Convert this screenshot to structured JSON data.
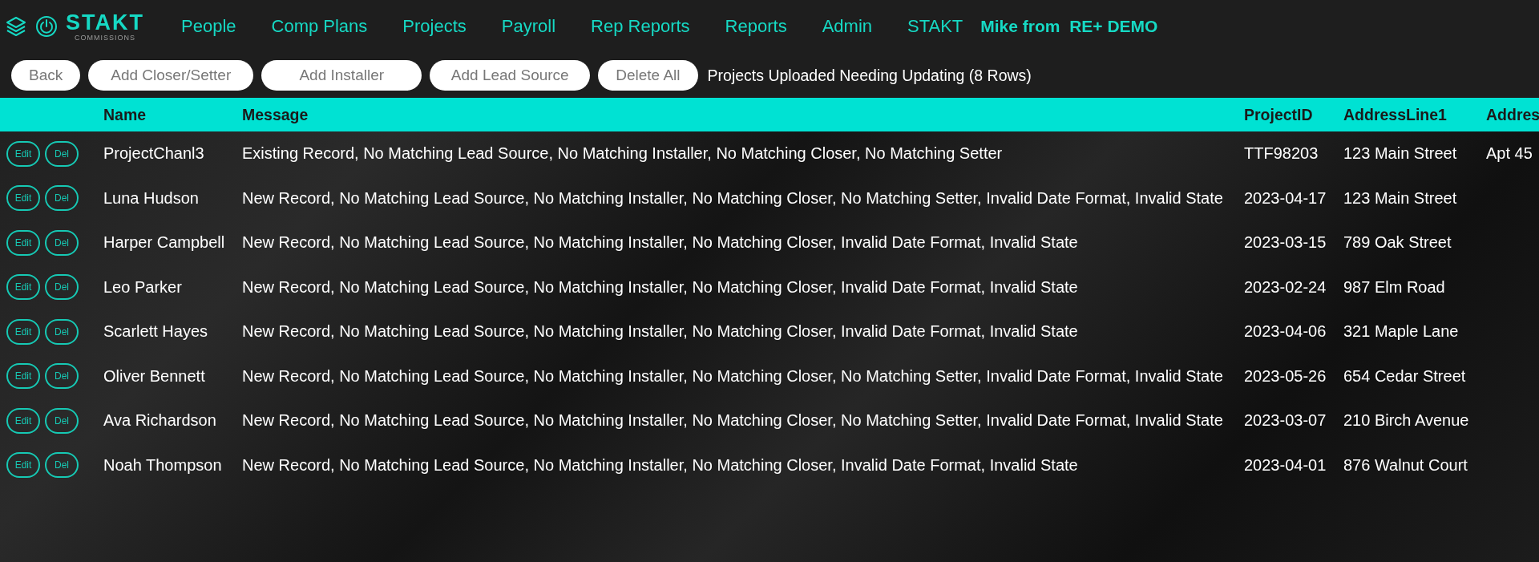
{
  "brand": {
    "name": "STAKT",
    "tagline": "COMMISSIONS"
  },
  "nav": [
    "People",
    "Comp Plans",
    "Projects",
    "Payroll",
    "Rep Reports",
    "Reports",
    "Admin",
    "STAKT"
  ],
  "user": "Mike from  RE+ DEMO",
  "toolbar": {
    "buttons": [
      "Back",
      "Add Closer/Setter",
      "Add Installer",
      "Add Lead Source",
      "Delete All"
    ],
    "title": "Projects Uploaded Needing Updating (8 Rows)"
  },
  "table": {
    "columns": [
      "Name",
      "Message",
      "ProjectID",
      "AddressLine1",
      "Addres"
    ],
    "rows": [
      {
        "actions": [
          "Edit",
          "Del"
        ],
        "cells": [
          "ProjectChanl3",
          "Existing Record, No Matching Lead Source, No Matching Installer, No Matching Closer, No Matching Setter",
          "TTF98203",
          "123 Main Street",
          "Apt 45"
        ]
      },
      {
        "actions": [
          "Edit",
          "Del"
        ],
        "cells": [
          "Luna Hudson",
          "New Record, No Matching Lead Source, No Matching Installer, No Matching Closer, No Matching Setter, Invalid Date Format, Invalid State",
          "2023-04-17",
          "123 Main Street"
        ]
      },
      {
        "actions": [
          "Edit",
          "Del"
        ],
        "cells": [
          "Harper Campbell",
          "New Record, No Matching Lead Source, No Matching Installer, No Matching Closer, Invalid Date Format, Invalid State",
          "2023-03-15",
          "789 Oak Street"
        ]
      },
      {
        "actions": [
          "Edit",
          "Del"
        ],
        "cells": [
          "Leo Parker",
          "New Record, No Matching Lead Source, No Matching Installer, No Matching Closer, Invalid Date Format, Invalid State",
          "2023-02-24",
          "987 Elm Road"
        ]
      },
      {
        "actions": [
          "Edit",
          "Del"
        ],
        "cells": [
          "Scarlett Hayes",
          "New Record, No Matching Lead Source, No Matching Installer, No Matching Closer, Invalid Date Format, Invalid State",
          "2023-04-06",
          "321 Maple Lane"
        ]
      },
      {
        "actions": [
          "Edit",
          "Del"
        ],
        "cells": [
          "Oliver Bennett",
          "New Record, No Matching Lead Source, No Matching Installer, No Matching Closer, No Matching Setter, Invalid Date Format, Invalid State",
          "2023-05-26",
          "654 Cedar Street"
        ]
      },
      {
        "actions": [
          "Edit",
          "Del"
        ],
        "cells": [
          "Ava Richardson",
          "New Record, No Matching Lead Source, No Matching Installer, No Matching Closer, No Matching Setter, Invalid Date Format, Invalid State",
          "2023-03-07",
          "210 Birch Avenue"
        ]
      },
      {
        "actions": [
          "Edit",
          "Del"
        ],
        "cells": [
          "Noah Thompson",
          "New Record, No Matching Lead Source, No Matching Installer, No Matching Closer, Invalid Date Format, Invalid State",
          "2023-04-01",
          "876 Walnut Court"
        ]
      }
    ]
  }
}
